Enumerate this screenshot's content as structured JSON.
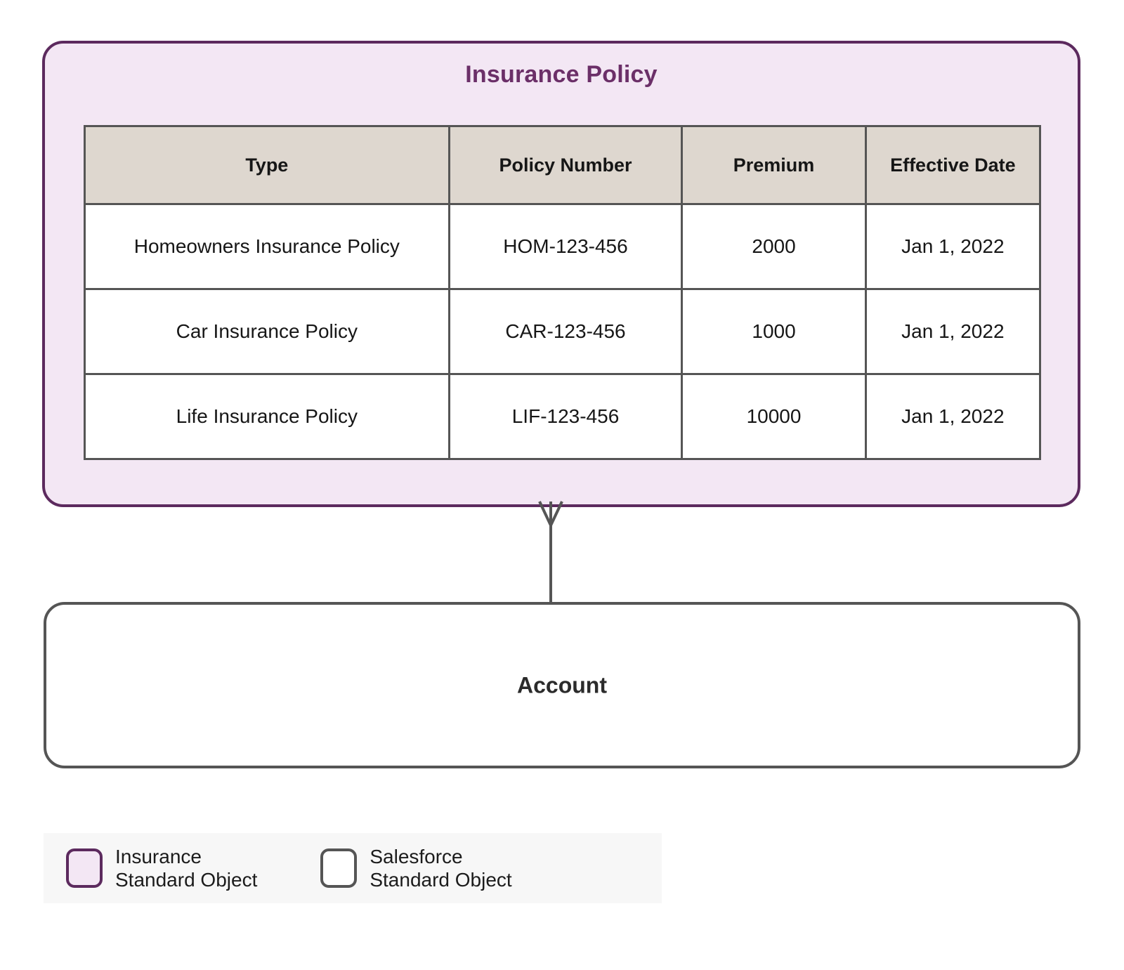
{
  "diagram": {
    "entities": {
      "insurance_policy": {
        "title": "Insurance Policy",
        "type": "insurance-standard-object",
        "accent_color": "#5C2A5E",
        "fill_color": "#F3E7F4",
        "table": {
          "header_background": "#DED7CF",
          "columns": [
            "Type",
            "Policy Number",
            "Premium",
            "Effective Date"
          ],
          "rows": [
            {
              "type": "Homeowners Insurance Policy",
              "policy_number": "HOM-123-456",
              "premium": "2000",
              "effective_date": "Jan 1, 2022"
            },
            {
              "type": "Car Insurance Policy",
              "policy_number": "CAR-123-456",
              "premium": "1000",
              "effective_date": "Jan 1, 2022"
            },
            {
              "type": "Life Insurance Policy",
              "policy_number": "LIF-123-456",
              "premium": "10000",
              "effective_date": "Jan 1, 2022"
            }
          ]
        }
      },
      "account": {
        "title": "Account",
        "type": "salesforce-standard-object",
        "accent_color": "#555555",
        "fill_color": "#FFFFFF"
      }
    },
    "relationship": {
      "from": "Insurance Policy",
      "to": "Account",
      "notation": "crows-foot",
      "cardinality": "many-to-one",
      "line_color": "#555555"
    },
    "legend": {
      "background": "#F7F7F7",
      "items": [
        {
          "line1": "Insurance",
          "line2": "Standard Object",
          "swatch_fill": "#F3E7F4",
          "swatch_border": "#5C2A5E"
        },
        {
          "line1": "Salesforce",
          "line2": "Standard Object",
          "swatch_fill": "#FFFFFF",
          "swatch_border": "#555555"
        }
      ]
    }
  }
}
